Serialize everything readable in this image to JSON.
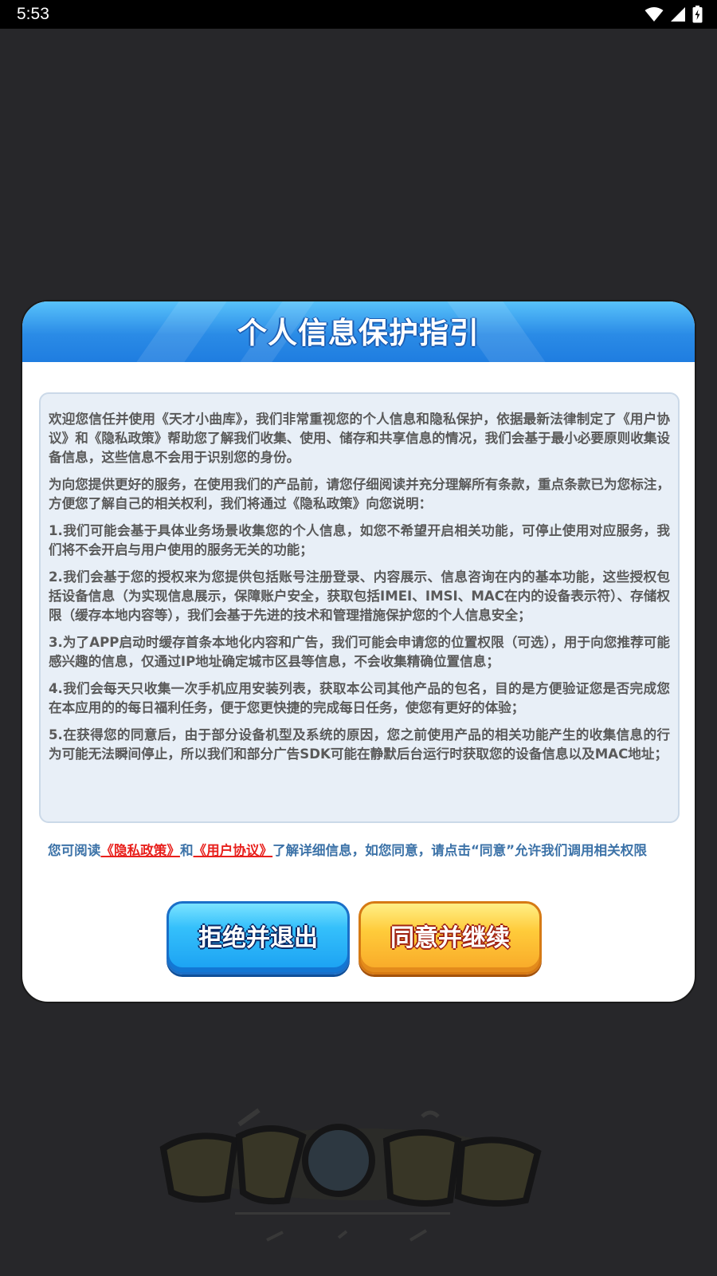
{
  "status_bar": {
    "time": "5:53",
    "icons": [
      "wifi-icon",
      "signal-icon",
      "battery-icon"
    ]
  },
  "dialog": {
    "title": "个人信息保护指引",
    "terms": [
      "欢迎您信任并使用《天才小曲库》，我们非常重视您的个人信息和隐私保护，依据最新法律制定了《用户协议》和《隐私政策》帮助您了解我们收集、使用、储存和共享信息的情况，我们会基于最小必要原则收集设备信息，这些信息不会用于识别您的身份。",
      "为向您提供更好的服务，在使用我们的产品前，请您仔细阅读并充分理解所有条款，重点条款已为您标注，方便您了解自己的相关权利，我们将通过《隐私政策》向您说明：",
      "1.我们可能会基于具体业务场景收集您的个人信息，如您不希望开启相关功能，可停止使用对应服务，我们将不会开启与用户使用的服务无关的功能；",
      "2.我们会基于您的授权来为您提供包括账号注册登录、内容展示、信息咨询在内的基本功能，这些授权包括设备信息（为实现信息展示，保障账户安全，获取包括IMEI、IMSI、MAC在内的设备表示符）、存储权限（缓存本地内容等），我们会基于先进的技术和管理措施保护您的个人信息安全；",
      "3.为了APP启动时缓存首条本地化内容和广告，我们可能会申请您的位置权限（可选），用于向您推荐可能感兴趣的信息，仅通过IP地址确定城市区县等信息，不会收集精确位置信息；",
      "4.我们会每天只收集一次手机应用安装列表，获取本公司其他产品的包名，目的是方便验证您是否完成您在本应用的的每日福利任务，便于您更快捷的完成每日任务，使您有更好的体验；",
      "5.在获得您的同意后，由于部分设备机型及系统的原因，您之前使用产品的相关功能产生的收集信息的行为可能无法瞬间停止，所以我们和部分广告SDK可能在静默后台运行时获取您的设备信息以及MAC地址；"
    ],
    "consent": {
      "prefix": "您可阅读",
      "privacy_link": "《隐私政策》",
      "and": "和",
      "agreement_link": "《用户协议》",
      "suffix": "了解详细信息，如您同意，请点击“同意”允许我们调用相关权限"
    },
    "buttons": {
      "decline": "拒绝并退出",
      "agree": "同意并继续"
    }
  },
  "colors": {
    "header_blue": "#2a8be6",
    "link_red": "#e8201c",
    "note_blue": "#3d73a8",
    "decline_blue": "#35c0fb",
    "agree_orange": "#ffcb3a"
  },
  "background_logo": "tiancai-xiaoquku-logo"
}
